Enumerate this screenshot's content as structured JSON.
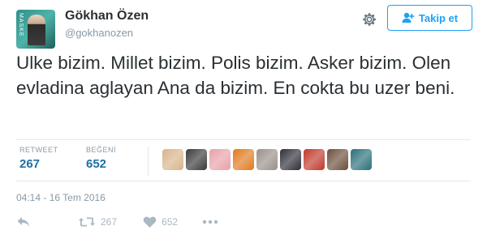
{
  "user": {
    "name": "Gökhan Özen",
    "handle": "@gokhanozen",
    "avatar_text": "MASKE"
  },
  "follow_button": {
    "label": "Takip et",
    "icon": "add-user-icon"
  },
  "settings_icon": "gear-icon",
  "tweet": {
    "text": "Ulke bizim. Millet bizim. Polis bizim. Asker bizim. Olen evladina aglayan Ana da bizim. En cokta bu uzer beni."
  },
  "stats": {
    "retweet_label": "RETWEET",
    "retweet_count": "267",
    "like_label": "BEĞENİ",
    "like_count": "652"
  },
  "likers": [
    {
      "color": "#d9b38c"
    },
    {
      "color": "#3a3a3a"
    },
    {
      "color": "#e8a0a8"
    },
    {
      "color": "#e07a1f"
    },
    {
      "color": "#9a8f88"
    },
    {
      "color": "#2f2f3a"
    },
    {
      "color": "#c0392b"
    },
    {
      "color": "#6b4f3a"
    },
    {
      "color": "#2a6f7a"
    }
  ],
  "timestamp": "04:14 - 16 Tem 2016",
  "actions": {
    "reply_icon": "reply-icon",
    "retweet_icon": "retweet-icon",
    "retweet_count": "267",
    "like_icon": "heart-icon",
    "like_count": "652",
    "more_icon": "more-icon"
  },
  "colors": {
    "accent": "#1da1f2",
    "stat_value": "#1d6fa5",
    "muted": "#8899a6",
    "text": "#292f33",
    "divider": "#e1e8ed"
  }
}
